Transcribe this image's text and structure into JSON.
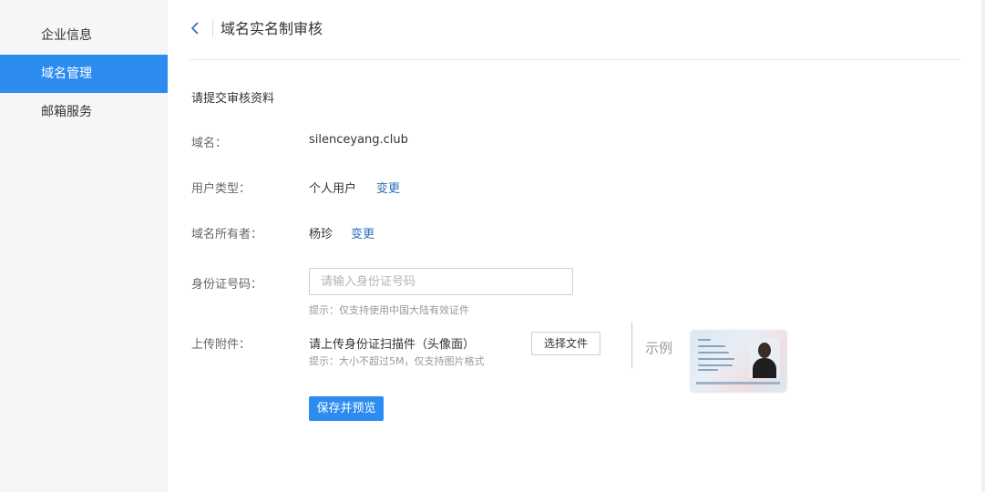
{
  "sidebar": {
    "items": [
      {
        "label": "企业信息",
        "active": false
      },
      {
        "label": "域名管理",
        "active": true
      },
      {
        "label": "邮箱服务",
        "active": false
      }
    ]
  },
  "header": {
    "back_icon": "chevron-left-icon",
    "title": "域名实名制审核"
  },
  "form": {
    "section_title": "请提交审核资料",
    "domain": {
      "label": "域名：",
      "value": "silenceyang.club"
    },
    "user_type": {
      "label": "用户类型：",
      "value": "个人用户",
      "change": "变更"
    },
    "owner": {
      "label": "域名所有者：",
      "value": "杨珍",
      "change": "变更"
    },
    "id_number": {
      "label": "身份证号码：",
      "placeholder": "请输入身份证号码",
      "value": "",
      "hint": "提示：仅支持使用中国大陆有效证件"
    },
    "attachment": {
      "label": "上传附件：",
      "instruction": "请上传身份证扫描件（头像面）",
      "hint": "提示：大小不超过5M，仅支持图片格式",
      "button": "选择文件",
      "example_label": "示例"
    },
    "submit": "保存并预览"
  },
  "colors": {
    "accent": "#2d8cf0",
    "link": "#2d6fb8",
    "sidebar_bg": "#f5f6f8"
  }
}
